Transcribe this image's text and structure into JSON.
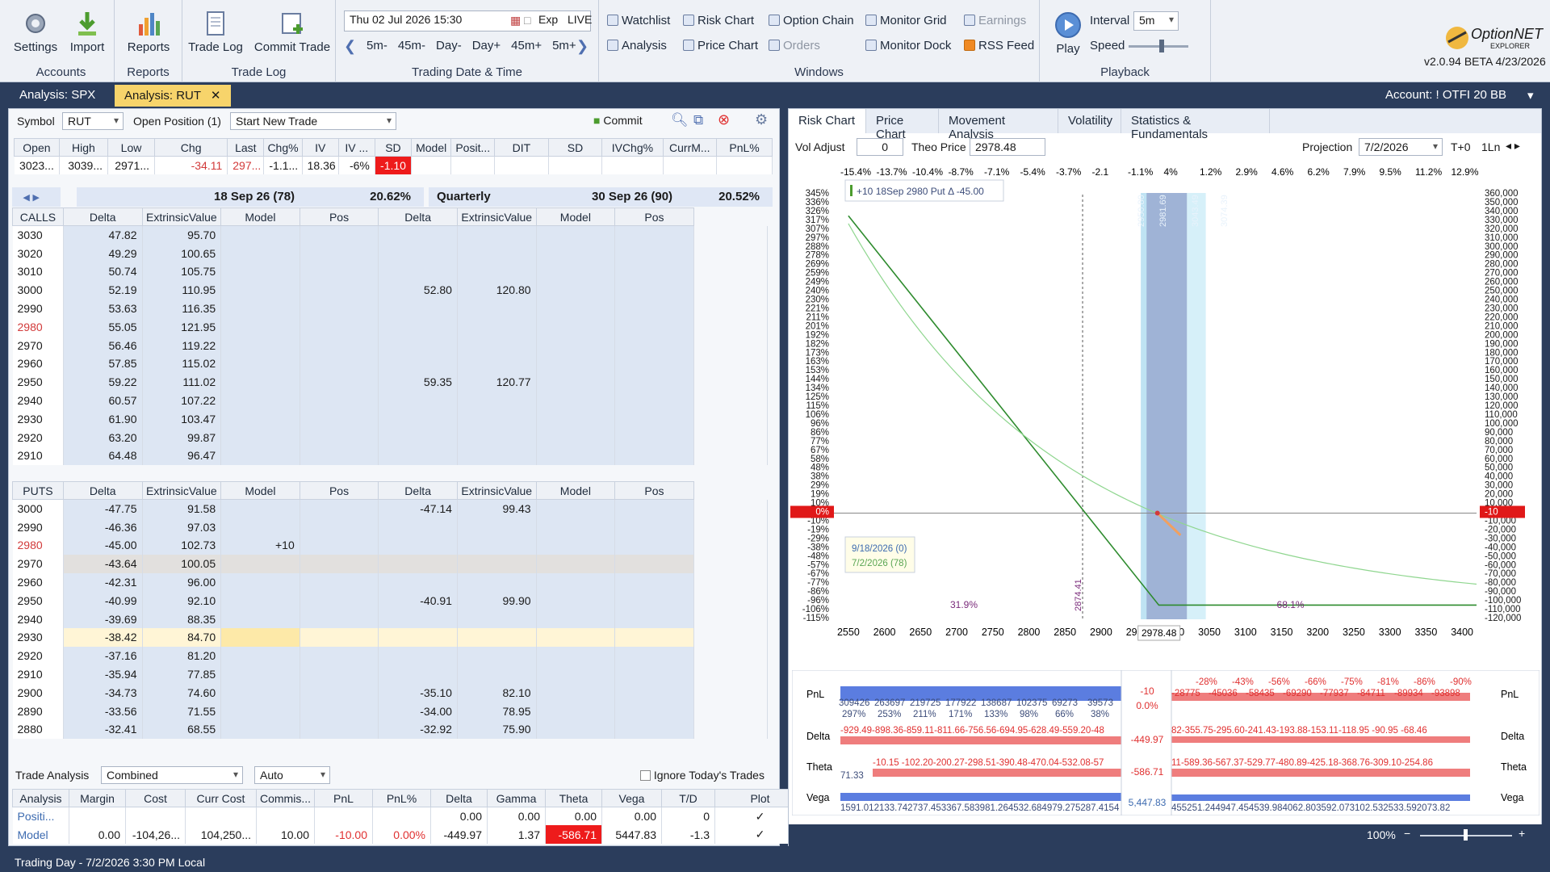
{
  "ribbon": {
    "accounts": {
      "label": "Accounts",
      "settings": "Settings",
      "import": "Import"
    },
    "reports": {
      "label": "Reports",
      "reports": "Reports"
    },
    "tradelog": {
      "label": "Trade Log",
      "trade_log": "Trade Log",
      "commit_trade": "Commit Trade"
    },
    "datetime": {
      "label": "Trading Date & Time",
      "date": "Thu 02 Jul 2026 15:30",
      "exp": "Exp",
      "live": "LIVE",
      "steps": [
        "5m-",
        "45m-",
        "Day-",
        "Day+",
        "45m+",
        "5m+"
      ]
    },
    "windows": {
      "label": "Windows",
      "watchlist": "Watchlist",
      "risk_chart": "Risk Chart",
      "option_chain": "Option Chain",
      "monitor_grid": "Monitor Grid",
      "earnings": "Earnings",
      "analysis": "Analysis",
      "price_chart": "Price Chart",
      "orders": "Orders",
      "monitor_dock": "Monitor Dock",
      "rss_feed": "RSS Feed"
    },
    "playback": {
      "label": "Playback",
      "play": "Play",
      "interval_label": "Interval",
      "interval_value": "5m",
      "speed_label": "Speed"
    },
    "brand": {
      "name": "OptionNET",
      "sub": "EXPLORER",
      "version": "v2.0.94 BETA 4/23/2026"
    }
  },
  "tabs": [
    {
      "label": "Analysis: SPX"
    },
    {
      "label": "Analysis: RUT",
      "close": "✕"
    }
  ],
  "account": "Account: ! OTFI 20 BB",
  "left": {
    "symbol_label": "Symbol",
    "symbol": "RUT",
    "open_pos_label": "Open Position (1)",
    "trade_select": "Start New Trade",
    "commit": "Commit",
    "quote_headers": [
      "Open",
      "High",
      "Low",
      "Chg",
      "Last",
      "Chg%",
      "IV",
      "IV ...",
      "SD",
      "Model",
      "Posit...",
      "DIT",
      "SD",
      "IVChg%",
      "CurrM...",
      "PnL%"
    ],
    "quote_values": [
      "3023...",
      "3039...",
      "2971...",
      "-34.11",
      "297...",
      "-1.1...",
      "18.36",
      "-6%",
      "-1.10",
      "",
      ""
    ],
    "exp1": {
      "date": "18 Sep 26 (78)",
      "iv": "20.62%"
    },
    "exp2": {
      "type": "Quarterly",
      "date": "30 Sep 26 (90)",
      "iv": "20.52%"
    },
    "col_headers": [
      "Delta",
      "ExtrinsicValue",
      "Model",
      "Pos"
    ],
    "calls_label": "CALLS",
    "puts_label": "PUTS",
    "calls": [
      {
        "strike": "3030",
        "d1": "47.82",
        "e1": "95.70",
        "d2": "",
        "e2": ""
      },
      {
        "strike": "3020",
        "d1": "49.29",
        "e1": "100.65",
        "d2": "",
        "e2": ""
      },
      {
        "strike": "3010",
        "d1": "50.74",
        "e1": "105.75",
        "d2": "",
        "e2": ""
      },
      {
        "strike": "3000",
        "d1": "52.19",
        "e1": "110.95",
        "d2": "52.80",
        "e2": "120.80"
      },
      {
        "strike": "2990",
        "d1": "53.63",
        "e1": "116.35",
        "d2": "",
        "e2": ""
      },
      {
        "strike": "2980",
        "d1": "55.05",
        "e1": "121.95",
        "d2": "",
        "e2": ""
      },
      {
        "strike": "2970",
        "d1": "56.46",
        "e1": "119.22",
        "d2": "",
        "e2": ""
      },
      {
        "strike": "2960",
        "d1": "57.85",
        "e1": "115.02",
        "d2": "",
        "e2": ""
      },
      {
        "strike": "2950",
        "d1": "59.22",
        "e1": "111.02",
        "d2": "59.35",
        "e2": "120.77"
      },
      {
        "strike": "2940",
        "d1": "60.57",
        "e1": "107.22",
        "d2": "",
        "e2": ""
      },
      {
        "strike": "2930",
        "d1": "61.90",
        "e1": "103.47",
        "d2": "",
        "e2": ""
      },
      {
        "strike": "2920",
        "d1": "63.20",
        "e1": "99.87",
        "d2": "",
        "e2": ""
      },
      {
        "strike": "2910",
        "d1": "64.48",
        "e1": "96.47",
        "d2": "",
        "e2": ""
      }
    ],
    "puts": [
      {
        "strike": "3000",
        "d1": "-47.75",
        "e1": "91.58",
        "m": "",
        "d2": "-47.14",
        "e2": "99.43"
      },
      {
        "strike": "2990",
        "d1": "-46.36",
        "e1": "97.03",
        "m": "",
        "d2": "",
        "e2": ""
      },
      {
        "strike": "2980",
        "d1": "-45.00",
        "e1": "102.73",
        "m": "+10",
        "d2": "",
        "e2": ""
      },
      {
        "strike": "2970",
        "d1": "-43.64",
        "e1": "100.05",
        "m": "",
        "d2": "",
        "e2": ""
      },
      {
        "strike": "2960",
        "d1": "-42.31",
        "e1": "96.00",
        "m": "",
        "d2": "",
        "e2": ""
      },
      {
        "strike": "2950",
        "d1": "-40.99",
        "e1": "92.10",
        "m": "",
        "d2": "-40.91",
        "e2": "99.90"
      },
      {
        "strike": "2940",
        "d1": "-39.69",
        "e1": "88.35",
        "m": "",
        "d2": "",
        "e2": ""
      },
      {
        "strike": "2930",
        "d1": "-38.42",
        "e1": "84.70",
        "m": "",
        "d2": "",
        "e2": ""
      },
      {
        "strike": "2920",
        "d1": "-37.16",
        "e1": "81.20",
        "m": "",
        "d2": "",
        "e2": ""
      },
      {
        "strike": "2910",
        "d1": "-35.94",
        "e1": "77.85",
        "m": "",
        "d2": "",
        "e2": ""
      },
      {
        "strike": "2900",
        "d1": "-34.73",
        "e1": "74.60",
        "m": "",
        "d2": "-35.10",
        "e2": "82.10"
      },
      {
        "strike": "2890",
        "d1": "-33.56",
        "e1": "71.55",
        "m": "",
        "d2": "-34.00",
        "e2": "78.95"
      },
      {
        "strike": "2880",
        "d1": "-32.41",
        "e1": "68.55",
        "m": "",
        "d2": "-32.92",
        "e2": "75.90"
      }
    ],
    "trade_analysis_label": "Trade Analysis",
    "trade_analysis_value": "Combined",
    "auto_value": "Auto",
    "ignore_label": "Ignore Today's Trades",
    "analysis_headers": [
      "Analysis",
      "Margin",
      "Cost",
      "Curr Cost",
      "Commis...",
      "PnL",
      "PnL%",
      "Delta",
      "Gamma",
      "Theta",
      "Vega",
      "T/D",
      "Plot"
    ],
    "analysis_rows": [
      [
        "Positi...",
        "",
        "",
        "",
        "",
        "",
        "",
        "0.00",
        "0.00",
        "0.00",
        "0.00",
        "0",
        "✓"
      ],
      [
        "Model",
        "0.00",
        "-104,26...",
        "104,250...",
        "10.00",
        "-10.00",
        "0.00%",
        "-449.97",
        "1.37",
        "-586.71",
        "5447.83",
        "-1.3",
        "✓"
      ]
    ]
  },
  "right": {
    "tabs": [
      "Risk Chart",
      "Price Chart",
      "Movement Analysis",
      "Volatility",
      "Statistics & Fundamentals"
    ],
    "vol_adjust_label": "Vol Adjust",
    "vol_adjust": "0",
    "theo_label": "Theo Price",
    "theo": "2978.48",
    "projection_label": "Projection",
    "projection": "7/2/2026",
    "t0": "T+0",
    "lines": "1Ln",
    "move_pcts": [
      "-15.4%",
      "-13.7%",
      "-10.4%",
      "-8.7%",
      "-7.1%",
      "-5.4%",
      "-3.7%",
      "-2.1",
      "-1.1%",
      "4%",
      "1.2%",
      "2.9%",
      "4.6%",
      "6.2%",
      "7.9%",
      "9.5%",
      "11.2%",
      "12.9%"
    ],
    "left_axis": [
      "345%",
      "336%",
      "326%",
      "317%",
      "307%",
      "297%",
      "288%",
      "278%",
      "269%",
      "259%",
      "249%",
      "240%",
      "230%",
      "221%",
      "211%",
      "201%",
      "192%",
      "182%",
      "173%",
      "163%",
      "153%",
      "144%",
      "134%",
      "125%",
      "115%",
      "106%",
      "96%",
      "86%",
      "77%",
      "67%",
      "58%",
      "48%",
      "38%",
      "29%",
      "19%",
      "10%",
      "0%",
      "-10%",
      "-19%",
      "-29%",
      "-38%",
      "-48%",
      "-57%",
      "-67%",
      "-77%",
      "-86%",
      "-96%",
      "-106%",
      "-115%"
    ],
    "right_axis": [
      "360,000",
      "350,000",
      "340,000",
      "330,000",
      "320,000",
      "310,000",
      "300,000",
      "290,000",
      "280,000",
      "270,000",
      "260,000",
      "250,000",
      "240,000",
      "230,000",
      "220,000",
      "210,000",
      "200,000",
      "190,000",
      "180,000",
      "170,000",
      "160,000",
      "150,000",
      "140,000",
      "130,000",
      "120,000",
      "110,000",
      "100,000",
      "90,000",
      "80,000",
      "70,000",
      "60,000",
      "50,000",
      "40,000",
      "30,000",
      "20,000",
      "10,000",
      "-10",
      "-10,000",
      "-20,000",
      "-30,000",
      "-40,000",
      "-50,000",
      "-60,000",
      "-70,000",
      "-80,000",
      "-90,000",
      "-100,000",
      "-110,000",
      "-120,000"
    ],
    "x_ticks": [
      "2550",
      "2600",
      "2650",
      "2700",
      "2750",
      "2800",
      "2850",
      "2900",
      "2950",
      "3000",
      "3050",
      "3100",
      "3150",
      "3200",
      "3250",
      "3300",
      "3350",
      "3400"
    ],
    "x_values": [
      2550,
      2600,
      2650,
      2700,
      2750,
      2800,
      2850,
      2900,
      2950,
      3000,
      3050,
      3100,
      3150,
      3200,
      3250,
      3300,
      3350,
      3400
    ],
    "current_price": "2978.48",
    "tooltip": "+10 18Sep 2980 Put Δ  -45.00",
    "legend_line1": "9/18/2026 (0)",
    "legend_line2": "7/2/2026 (78)",
    "vertical_labels": [
      "2874.41",
      "2950.80",
      "2981.69",
      "3043.49",
      "3074.39"
    ],
    "prob_left": "31.9%",
    "prob_right": "68.1%",
    "pnl_badge": "-10",
    "pnl_badge_left": "0%",
    "greeks": {
      "labels": [
        "PnL",
        "Delta",
        "Theta",
        "Vega"
      ],
      "pnl_top": [
        "-28%",
        "-43%",
        "-56%",
        "-66%",
        "-75%",
        "-81%",
        "-86%",
        "-90%"
      ],
      "pnl_left": [
        "309426",
        "263697",
        "219725",
        "177922",
        "138687",
        "102375",
        "69273",
        "39573"
      ],
      "pnl_pct_left": [
        "297%",
        "253%",
        "211%",
        "171%",
        "133%",
        "98%",
        "66%",
        "38%"
      ],
      "pnl_right": [
        "-28775",
        "-45036",
        "-58435",
        "-69290",
        "-77937",
        "-84711",
        "-89934",
        "-93898"
      ],
      "pnl_cur": "-10",
      "pnl_cur_pct": "0.0%",
      "delta_row": "-929.49-898.36-859.11-811.66-756.56-694.95-628.49-559.20-48",
      "delta_right": "82-355.75-295.60-241.43-193.88-153.11-118.95 -90.95 -68.46",
      "delta_cur": "-449.97",
      "theta_row": "-10.15 -102.20-200.27-298.51-390.48-470.04-532.08-57",
      "theta_right": "11-589.36-567.37-529.77-480.89-425.18-368.76-309.10-254.86",
      "theta_left": "71.33",
      "theta_cur": "-586.71",
      "vega_row": "1591.012133.742737.453367.583981.264532.684979.275287.4154",
      "vega_right": "455251.244947.454539.984062.803592.073102.532533.592073.82",
      "vega_cur": "5,447.83"
    },
    "zoom": "100%"
  },
  "status": "Trading Day - 7/2/2026 3:30 PM Local",
  "colors": {
    "accent": "#2b3d5c",
    "active_tab": "#f7d46b",
    "red": "#ee1b1b",
    "curve": "#2e8b2e",
    "band": "#9fb3d6"
  }
}
